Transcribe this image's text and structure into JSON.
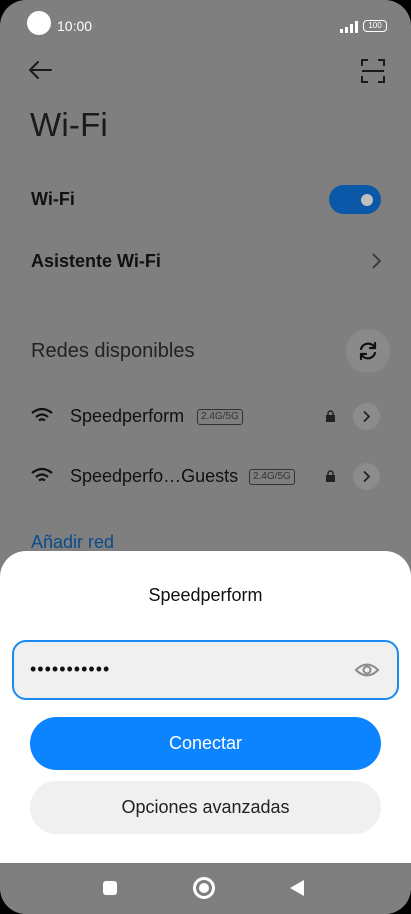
{
  "status_bar": {
    "time": "10:00",
    "battery": "100"
  },
  "header": {
    "title": "Wi-Fi"
  },
  "wifi_toggle": {
    "label": "Wi-Fi",
    "on": true
  },
  "assistant": {
    "label": "Asistente Wi-Fi"
  },
  "networks_section": {
    "title": "Redes disponibles",
    "networks": [
      {
        "name": "Speedperform",
        "band": "2.4G/5G",
        "secured": true
      },
      {
        "name": "Speedperfo…Guests",
        "band": "2.4G/5G",
        "secured": true
      }
    ],
    "add_network_label": "Añadir red"
  },
  "dialog": {
    "title": "Speedperform",
    "password_value": "•••••••••••",
    "connect_label": "Conectar",
    "advanced_label": "Opciones avanzadas"
  },
  "colors": {
    "accent": "#0d84ff",
    "toggle_on": "#0b57a8",
    "overlay": "#7f7f7f",
    "field_border": "#1a8bf0"
  },
  "icons": {
    "back": "arrow-left-icon",
    "scan": "scan-qr-icon",
    "refresh": "refresh-icon",
    "wifi": "wifi-icon",
    "lock": "lock-icon",
    "detail": "chevron-right-icon",
    "eye": "eye-icon"
  }
}
